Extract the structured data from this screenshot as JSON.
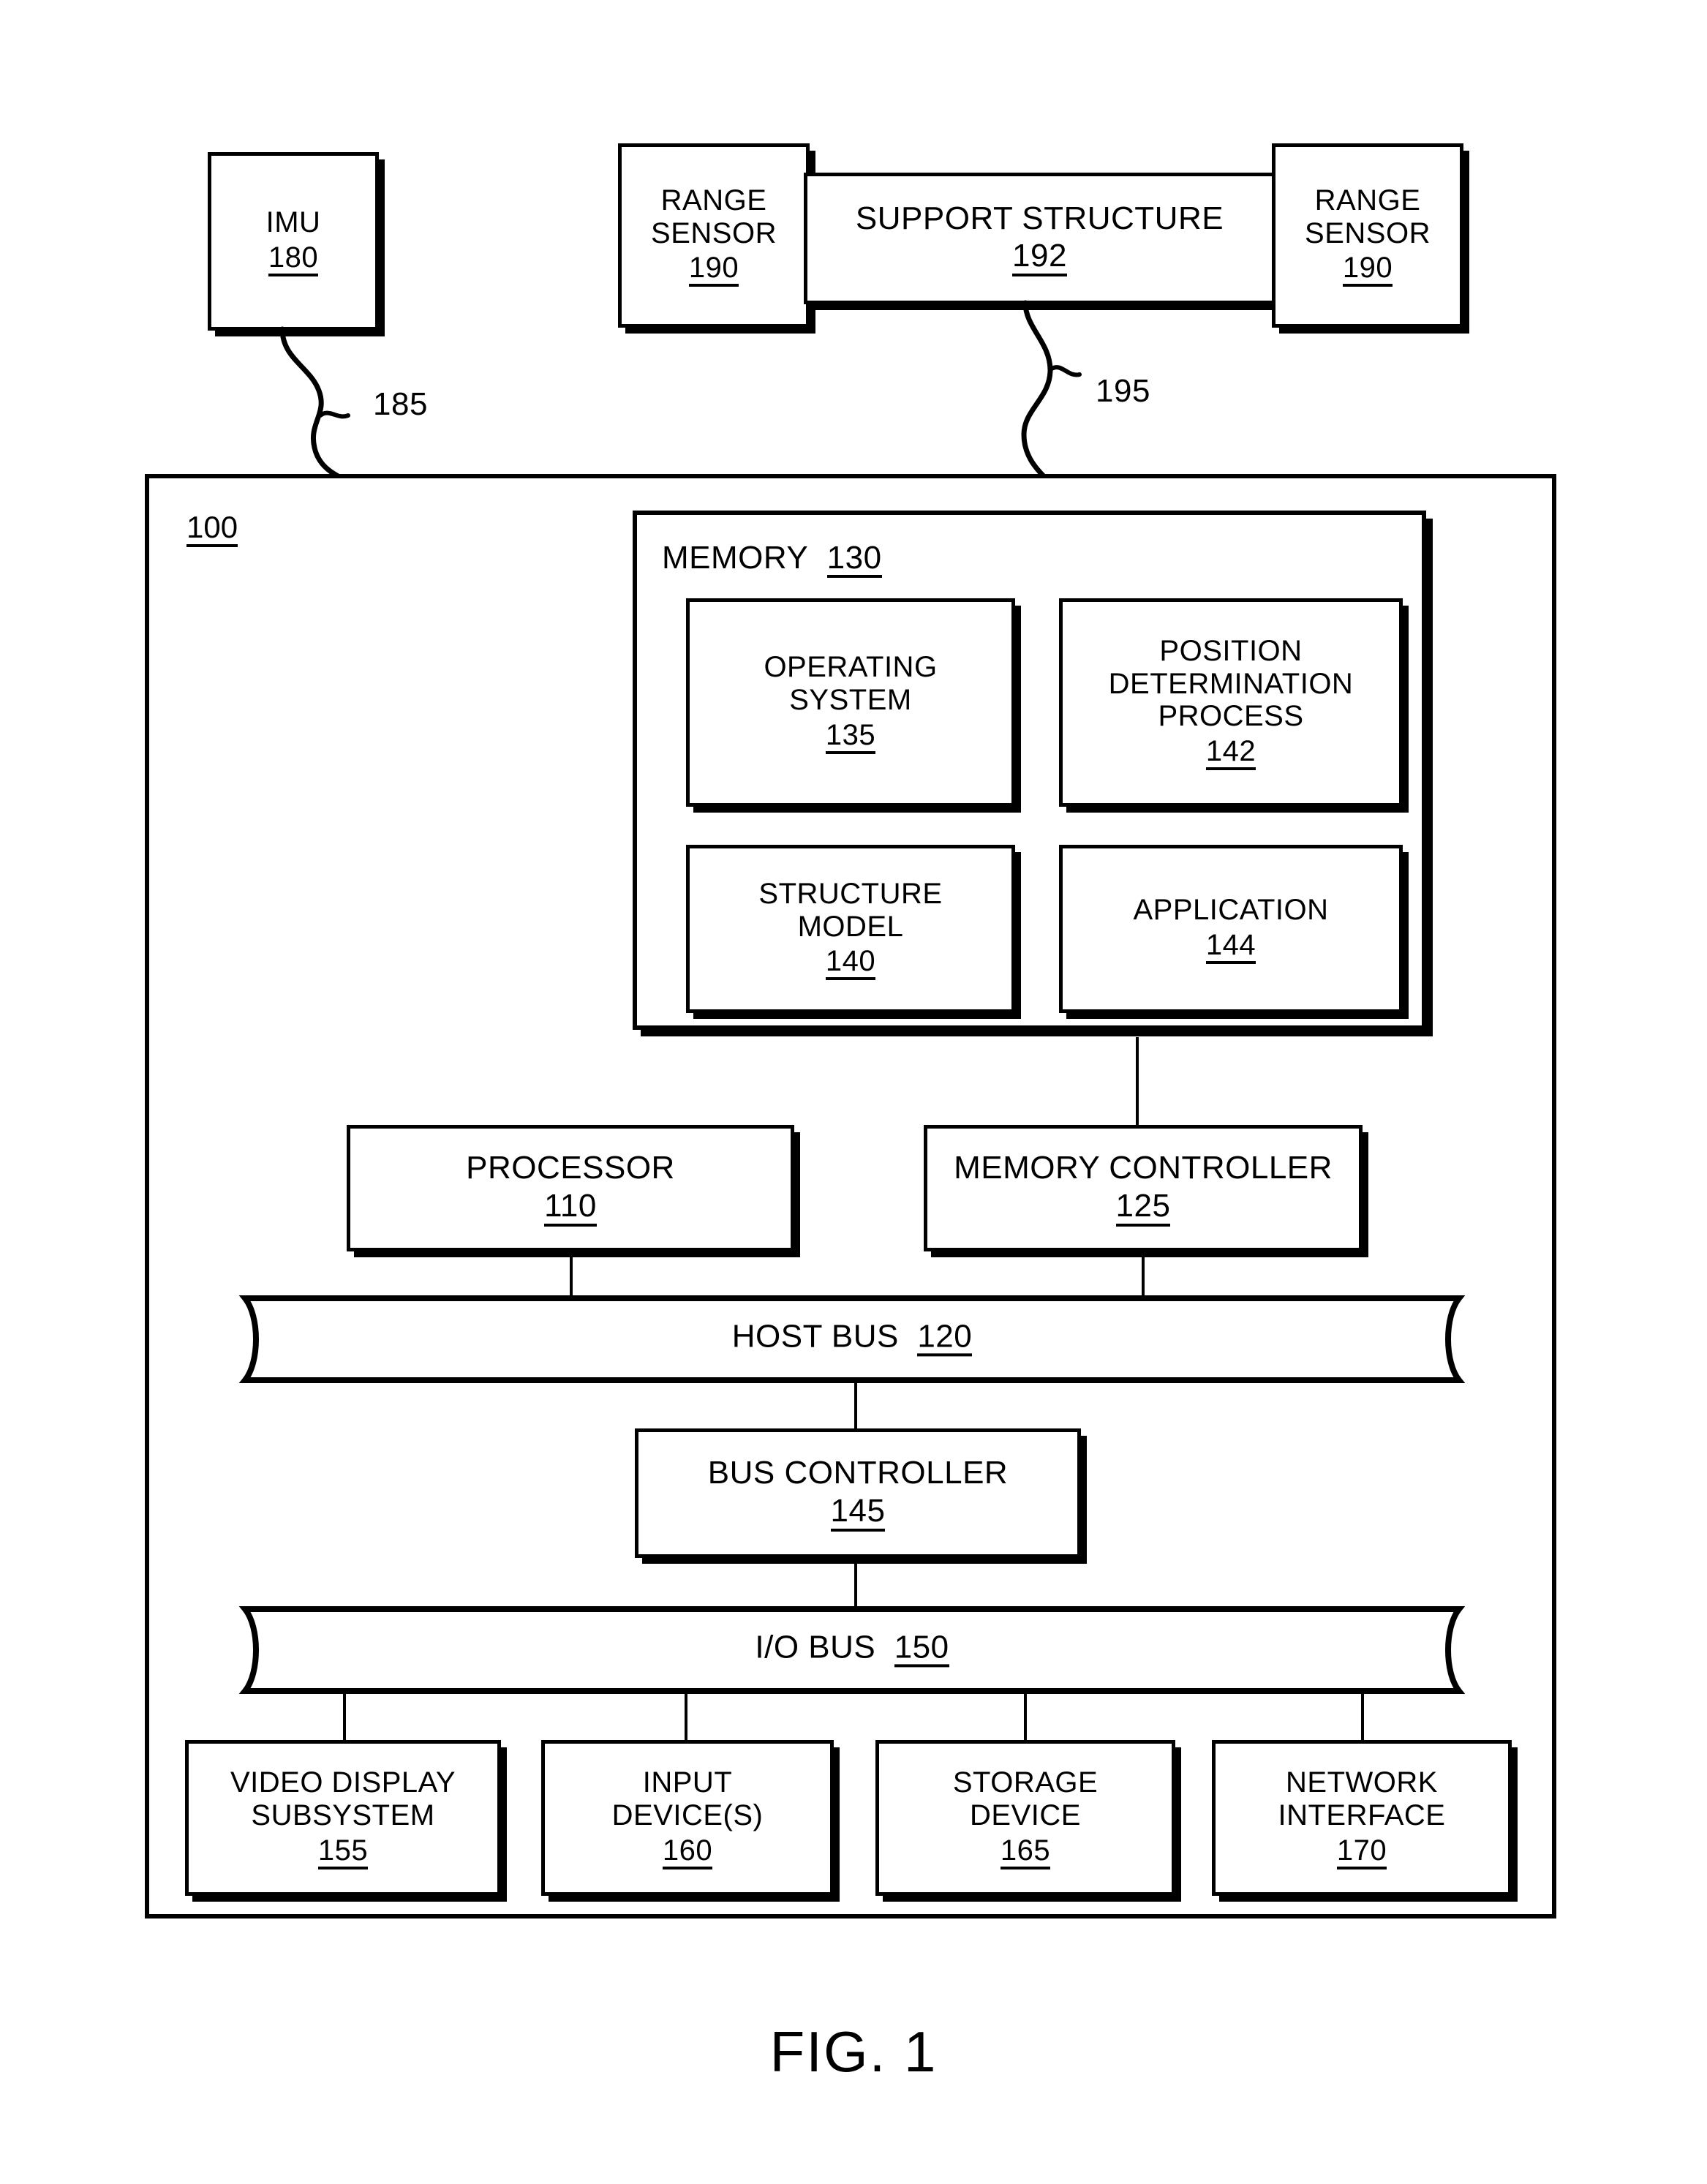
{
  "figure": {
    "caption": "FIG. 1",
    "system_label": "100"
  },
  "external_components": {
    "imu": {
      "name": "IMU",
      "ref": "180",
      "connector_ref": "185"
    },
    "range_sensor_left": {
      "name": "RANGE\nSENSOR",
      "ref": "190"
    },
    "range_sensor_right": {
      "name": "RANGE\nSENSOR",
      "ref": "190"
    },
    "support_structure": {
      "name": "SUPPORT STRUCTURE",
      "ref": "192",
      "connector_ref": "195"
    }
  },
  "memory": {
    "title": "MEMORY",
    "ref": "130",
    "modules": [
      {
        "name": "OPERATING\nSYSTEM",
        "ref": "135"
      },
      {
        "name": "POSITION\nDETERMINATION\nPROCESS",
        "ref": "142"
      },
      {
        "name": "STRUCTURE\nMODEL",
        "ref": "140"
      },
      {
        "name": "APPLICATION",
        "ref": "144"
      }
    ]
  },
  "core": {
    "processor": {
      "name": "PROCESSOR",
      "ref": "110"
    },
    "memory_controller": {
      "name": "MEMORY CONTROLLER",
      "ref": "125"
    },
    "host_bus": {
      "name": "HOST BUS",
      "ref": "120"
    },
    "bus_controller": {
      "name": "BUS CONTROLLER",
      "ref": "145"
    },
    "io_bus": {
      "name": "I/O BUS",
      "ref": "150"
    }
  },
  "peripherals": [
    {
      "name": "VIDEO DISPLAY\nSUBSYSTEM",
      "ref": "155"
    },
    {
      "name": "INPUT\nDEVICE(S)",
      "ref": "160"
    },
    {
      "name": "STORAGE\nDEVICE",
      "ref": "165"
    },
    {
      "name": "NETWORK\nINTERFACE",
      "ref": "170"
    }
  ],
  "colors": {
    "line": "#000000",
    "background": "#ffffff"
  }
}
